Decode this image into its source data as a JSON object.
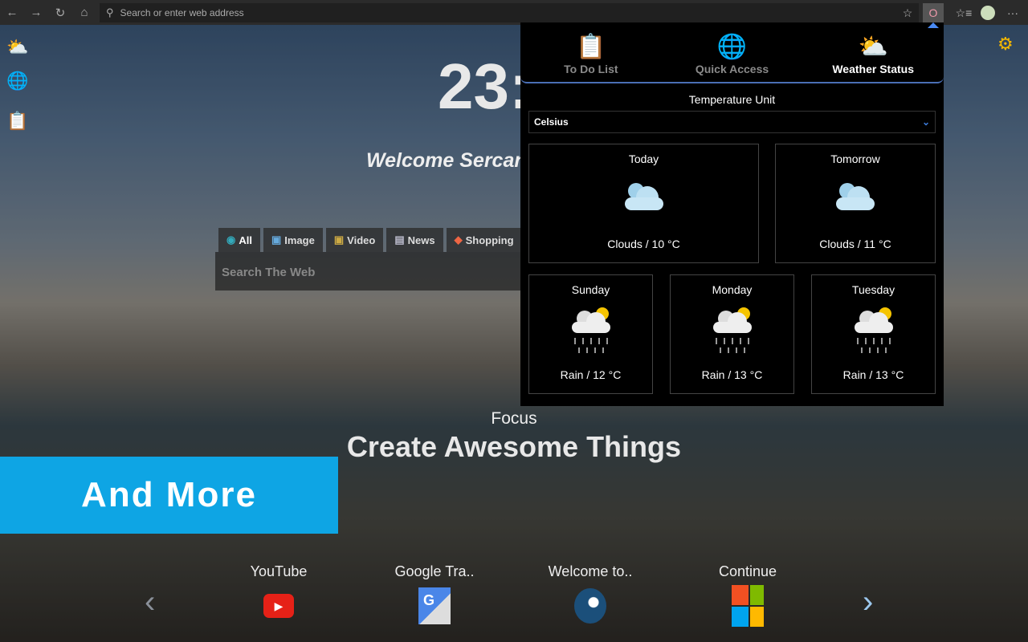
{
  "browser": {
    "address_placeholder": "Search or enter web address"
  },
  "clock": {
    "time": "23:"
  },
  "greeting": "Welcome Sercan ,",
  "search": {
    "tabs": [
      {
        "label": "All",
        "icon": "globe-icon"
      },
      {
        "label": "Image",
        "icon": "camera-icon"
      },
      {
        "label": "Video",
        "icon": "video-icon"
      },
      {
        "label": "News",
        "icon": "news-icon"
      },
      {
        "label": "Shopping",
        "icon": "tag-icon"
      }
    ],
    "placeholder": "Search The Web"
  },
  "panel": {
    "tabs": [
      {
        "label": "To Do List",
        "icon": "todo-icon"
      },
      {
        "label": "Quick Access",
        "icon": "globe-icon"
      },
      {
        "label": "Weather Status",
        "icon": "weather-icon",
        "active": true
      }
    ],
    "unit_label": "Temperature Unit",
    "unit_value": "Celsius",
    "forecast": [
      {
        "day": "Today",
        "cond": "Clouds / 10 °C",
        "icon": "cloud-icon"
      },
      {
        "day": "Tomorrow",
        "cond": "Clouds / 11 °C",
        "icon": "cloud-icon"
      },
      {
        "day": "Sunday",
        "cond": "Rain / 12 °C",
        "icon": "rain-icon"
      },
      {
        "day": "Monday",
        "cond": "Rain / 13 °C",
        "icon": "rain-icon"
      },
      {
        "day": "Tuesday",
        "cond": "Rain / 13 °C",
        "icon": "rain-icon"
      }
    ]
  },
  "focus": {
    "label": "Focus",
    "text": "Create Awesome Things"
  },
  "banner": "And More",
  "quick_links": [
    {
      "label": "YouTube",
      "icon": "youtube-icon"
    },
    {
      "label": "Google Tra..",
      "icon": "google-translate-icon"
    },
    {
      "label": "Welcome to..",
      "icon": "steam-icon"
    },
    {
      "label": "Continue",
      "icon": "microsoft-icon"
    }
  ],
  "colors": {
    "accent": "#0ea5e4",
    "panel_border": "#4a6fb5"
  }
}
